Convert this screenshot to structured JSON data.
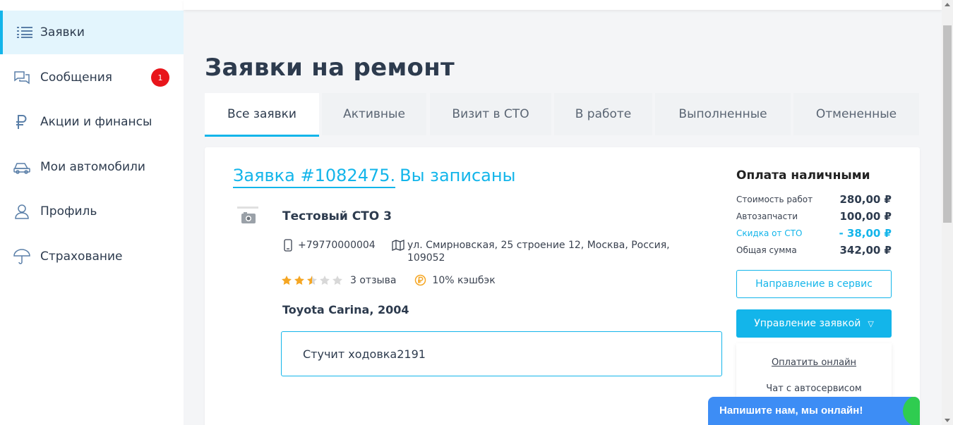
{
  "sidebar": {
    "items": [
      {
        "label": "Заявки",
        "icon": "list-icon",
        "active": true
      },
      {
        "label": "Сообщения",
        "icon": "chat-icon",
        "badge": "1"
      },
      {
        "label": "Акции и финансы",
        "icon": "ruble-icon"
      },
      {
        "label": "Мои автомобили",
        "icon": "car-icon"
      },
      {
        "label": "Профиль",
        "icon": "user-icon"
      },
      {
        "label": "Страхование",
        "icon": "umbrella-icon"
      }
    ]
  },
  "page": {
    "title": "Заявки на ремонт"
  },
  "tabs": [
    "Все заявки",
    "Активные",
    "Визит в СТО",
    "В работе",
    "Выполненные",
    "Отмененные"
  ],
  "order": {
    "link": "Заявка #1082475.",
    "status": "Вы записаны",
    "sto_name": "Тестовый СТО 3",
    "phone": "+79770000004",
    "address": "ул. Смирновская, 25 строение 12, Москва, Россия, 109052",
    "rating": 2.5,
    "reviews": "3 отзыва",
    "cashback": "10% кэшбэк",
    "car": "Toyota Carina, 2004",
    "problem": "Стучит ходовка2191"
  },
  "payment": {
    "title": "Оплата наличными",
    "rows": [
      {
        "label": "Стоимость работ",
        "value": "280,00 ₽"
      },
      {
        "label": "Автозапчасти",
        "value": "100,00 ₽"
      },
      {
        "label": "Скидка от СТО",
        "value": "- 38,00 ₽"
      },
      {
        "label": "Общая сумма",
        "value": "342,00 ₽"
      }
    ],
    "btn_service": "Направление в сервис",
    "btn_manage": "Управление заявкой",
    "menu": [
      "Оплатить онлайн",
      "Чат с автосервисом"
    ]
  },
  "chat": {
    "text": "Напишите нам, мы онлайн!"
  },
  "colors": {
    "accent": "#13b5ea",
    "badge": "#e8151b",
    "star": "#f5a623",
    "chat": "#3d8df5"
  }
}
